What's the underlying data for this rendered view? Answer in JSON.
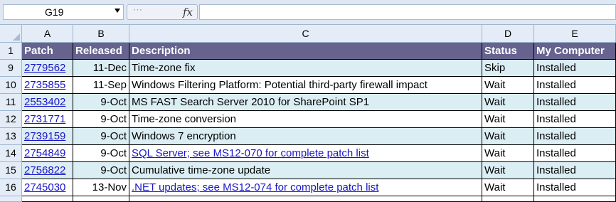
{
  "formula_bar": {
    "name_box": "G19",
    "fx_label": "fx",
    "dots": "⋯",
    "formula": ""
  },
  "columns": [
    "A",
    "B",
    "C",
    "D",
    "E"
  ],
  "header_row": {
    "row_number": "1",
    "cells": [
      "Patch",
      "Released",
      "Description",
      "Status",
      "My Computer"
    ]
  },
  "rows": [
    {
      "row_number": "9",
      "patch": "2779562",
      "released": "11-Dec",
      "description": "Time-zone fix",
      "description_link": false,
      "status": "Skip",
      "computer": "Installed"
    },
    {
      "row_number": "10",
      "patch": "2735855",
      "released": "11-Sep",
      "description": "Windows Filtering Platform: Potential third-party firewall impact",
      "description_link": false,
      "status": "Wait",
      "computer": "Installed"
    },
    {
      "row_number": "11",
      "patch": "2553402",
      "released": "9-Oct",
      "description": "MS FAST Search Server 2010 for SharePoint SP1",
      "description_link": false,
      "status": "Wait",
      "computer": "Installed"
    },
    {
      "row_number": "12",
      "patch": "2731771",
      "released": "9-Oct",
      "description": "Time-zone conversion",
      "description_link": false,
      "status": "Wait",
      "computer": "Installed"
    },
    {
      "row_number": "13",
      "patch": "2739159",
      "released": "9-Oct",
      "description": "Windows 7 encryption",
      "description_link": false,
      "status": "Wait",
      "computer": "Installed"
    },
    {
      "row_number": "14",
      "patch": "2754849",
      "released": "9-Oct",
      "description": "SQL Server; see MS12-070 for complete patch list",
      "description_link": true,
      "status": "Wait",
      "computer": "Installed"
    },
    {
      "row_number": "15",
      "patch": "2756822",
      "released": "9-Oct",
      "description": "Cumulative time-zone update",
      "description_link": false,
      "status": "Wait",
      "computer": "Installed"
    },
    {
      "row_number": "16",
      "patch": "2745030",
      "released": "13-Nov",
      "description": ".NET updates; see MS12-074 for complete patch list",
      "description_link": true,
      "status": "Wait",
      "computer": "Installed"
    }
  ],
  "colors": {
    "header_fill": "#66638f",
    "band_fill": "#dbeef4",
    "link": "#1a16c8"
  }
}
